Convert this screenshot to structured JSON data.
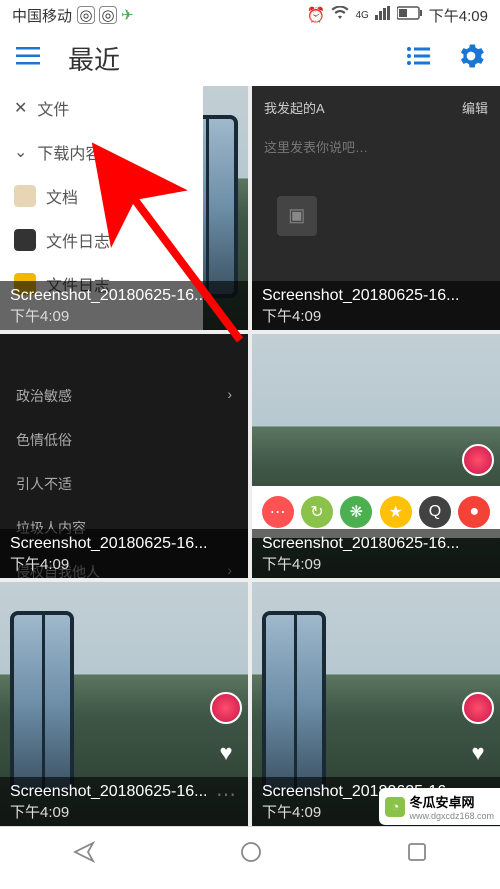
{
  "status_bar": {
    "carrier": "中国移动",
    "time": "下午4:09",
    "signal_4g": "4G"
  },
  "header": {
    "title": "最近"
  },
  "sidebar": {
    "items": [
      {
        "label": "文件",
        "icon": "close"
      },
      {
        "label": "下载内容",
        "icon": "chevron"
      },
      {
        "label": "文档",
        "icon_bg": "#e8d5b5"
      },
      {
        "label": "文件日志",
        "icon_bg": "#333"
      },
      {
        "label": "文件日志",
        "icon_bg": "#f0b800"
      }
    ]
  },
  "gallery": {
    "items": [
      {
        "filename": "Screenshot_20180625-16...",
        "time": "下午4:09"
      },
      {
        "filename": "Screenshot_20180625-16...",
        "time": "下午4:09"
      },
      {
        "filename": "Screenshot_20180625-16...",
        "time": "下午4:09"
      },
      {
        "filename": "Screenshot_20180625-16...",
        "time": "下午4:09"
      },
      {
        "filename": "Screenshot_20180625-16...",
        "time": "下午4:09"
      },
      {
        "filename": "Screenshot_20180625-16...",
        "time": "下午4:09"
      }
    ]
  },
  "dark_content": {
    "header_left": "我发起的A",
    "header_right": "编辑",
    "input_hint": "这里发表你说吧…",
    "menu_items": [
      "政治敏感",
      "色情低俗",
      "引人不适",
      "垃圾人内容",
      "侵权自我他人"
    ]
  },
  "watermark": {
    "text": "冬瓜安卓网",
    "url": "www.dgxcdz168.com"
  }
}
